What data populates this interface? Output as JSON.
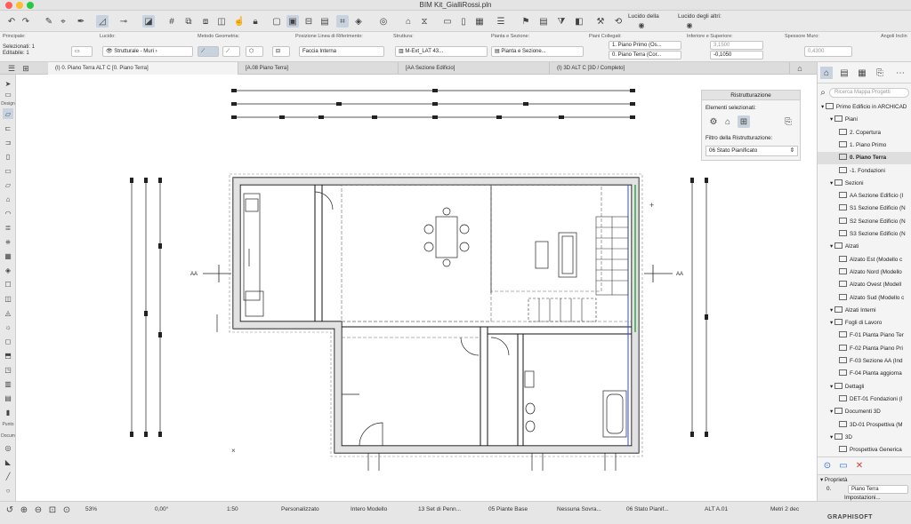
{
  "window": {
    "title": "BIM Kit_GialliRossi.pln",
    "traffic_colors": [
      "#ff5f57",
      "#febc2e",
      "#28c840"
    ]
  },
  "toolbar": {
    "lucido_della": "Lucido della",
    "lucido_degli_altri": "Lucido degli altri:"
  },
  "infobox": {
    "principale": "Principale:",
    "selezionati": "Selezionati: 1",
    "editabile": "Editabile: 1",
    "lucido": "Lucido:",
    "lucido_value": "Strutturale - Muri",
    "metodo_geometria": "Metodo Geometria:",
    "posizione_linea": "Posizione Linea di Riferimento:",
    "posizione_value": "Faccia Interna",
    "struttura": "Struttura:",
    "struttura_value": "M-Ext_LAT 43...",
    "pianta_sezione": "Pianta e Sezione:",
    "pianta_sezione_value": "Pianta e Sezione...",
    "piani_collegati": "Piani Collegati:",
    "piano_top": "1. Piano Primo (Os...",
    "piano_bottom": "0. Piano Terra (Cor...",
    "inferiore_superiore": "Inferiore e Superiore:",
    "val_top": "3,1500",
    "val_bottom": "-0,1050",
    "spessore_muro": "Spessore Muro:",
    "spessore_value": "0,4300",
    "angoli_inclinazione": "Angoli Inclin"
  },
  "tabs": [
    {
      "label": "(I) 0. Piano Terra ALT C [0. Piano Terra]"
    },
    {
      "label": "[A.08 Piano Terra]"
    },
    {
      "label": "[AA Sezione Edificio]"
    },
    {
      "label": "(I) 3D ALT C [3D / Completo]"
    }
  ],
  "leftbar": {
    "design": "Design",
    "punto": "Punto",
    "docum": "Docum"
  },
  "canvas": {
    "section_label_left": "AA",
    "section_label_right": "AA"
  },
  "renovation_palette": {
    "title": "Ristrutturazione",
    "elementi_selezionati": "Elementi selezionati:",
    "filtro_label": "Filtro della Ristrutturazione:",
    "filtro_value": "06 Stato Pianificato"
  },
  "navigator": {
    "search_placeholder": "Ricerca Mappa Progetti",
    "tree": [
      {
        "label": "Primo Edificio in ARCHICAD",
        "level": 0
      },
      {
        "label": "Piani",
        "level": 1
      },
      {
        "label": "2. Copertura",
        "level": 2
      },
      {
        "label": "1. Piano Primo",
        "level": 2
      },
      {
        "label": "0. Piano Terra",
        "level": 2,
        "selected": true
      },
      {
        "label": "-1. Fondazioni",
        "level": 2
      },
      {
        "label": "Sezioni",
        "level": 1
      },
      {
        "label": "AA Sezione Edificio (I",
        "level": 2
      },
      {
        "label": "S1 Sezione Edificio (N",
        "level": 2
      },
      {
        "label": "S2 Sezione Edificio (N",
        "level": 2
      },
      {
        "label": "S3 Sezione Edificio (N",
        "level": 2
      },
      {
        "label": "Alzati",
        "level": 1
      },
      {
        "label": "Alzato Est (Modello c",
        "level": 2
      },
      {
        "label": "Alzato Nord (Modello",
        "level": 2
      },
      {
        "label": "Alzato Ovest (Modell",
        "level": 2
      },
      {
        "label": "Alzato Sud (Modello c",
        "level": 2
      },
      {
        "label": "Alzati Interni",
        "level": 1
      },
      {
        "label": "Fogli di Lavoro",
        "level": 1
      },
      {
        "label": "F-01 Pianta Piano Ter",
        "level": 2
      },
      {
        "label": "F-02 Pianta Piano Pri",
        "level": 2
      },
      {
        "label": "F-03 Sezione AA (Ind",
        "level": 2
      },
      {
        "label": "F-04 Pianta aggiorna",
        "level": 2
      },
      {
        "label": "Dettagli",
        "level": 1
      },
      {
        "label": "DET-01 Fondazioni (I",
        "level": 2
      },
      {
        "label": "Documenti 3D",
        "level": 1
      },
      {
        "label": "3D-01 Prospettiva (M",
        "level": 2
      },
      {
        "label": "3D",
        "level": 1
      },
      {
        "label": "Prospettiva Generica",
        "level": 2
      }
    ],
    "properties_title": "Proprietà",
    "prop_id": "0.",
    "prop_name": "Piano Terra",
    "impostazioni": "Impostazioni..."
  },
  "statusbar": {
    "zoom": "53%",
    "angle": "0,00°",
    "scale": "1:50",
    "personalizzato": "Personalizzato",
    "intero_modello": "Intero Modello",
    "set_penne": "13 Set di Penn...",
    "piante_base": "05 Piante Base",
    "nessuna_sovra": "Nessuna Sovra...",
    "stato_pianif": "06 Stato Pianif...",
    "alt": "ALT A.01",
    "metri": "Metri 2 dec",
    "logo": "GRAPHISOFT"
  }
}
